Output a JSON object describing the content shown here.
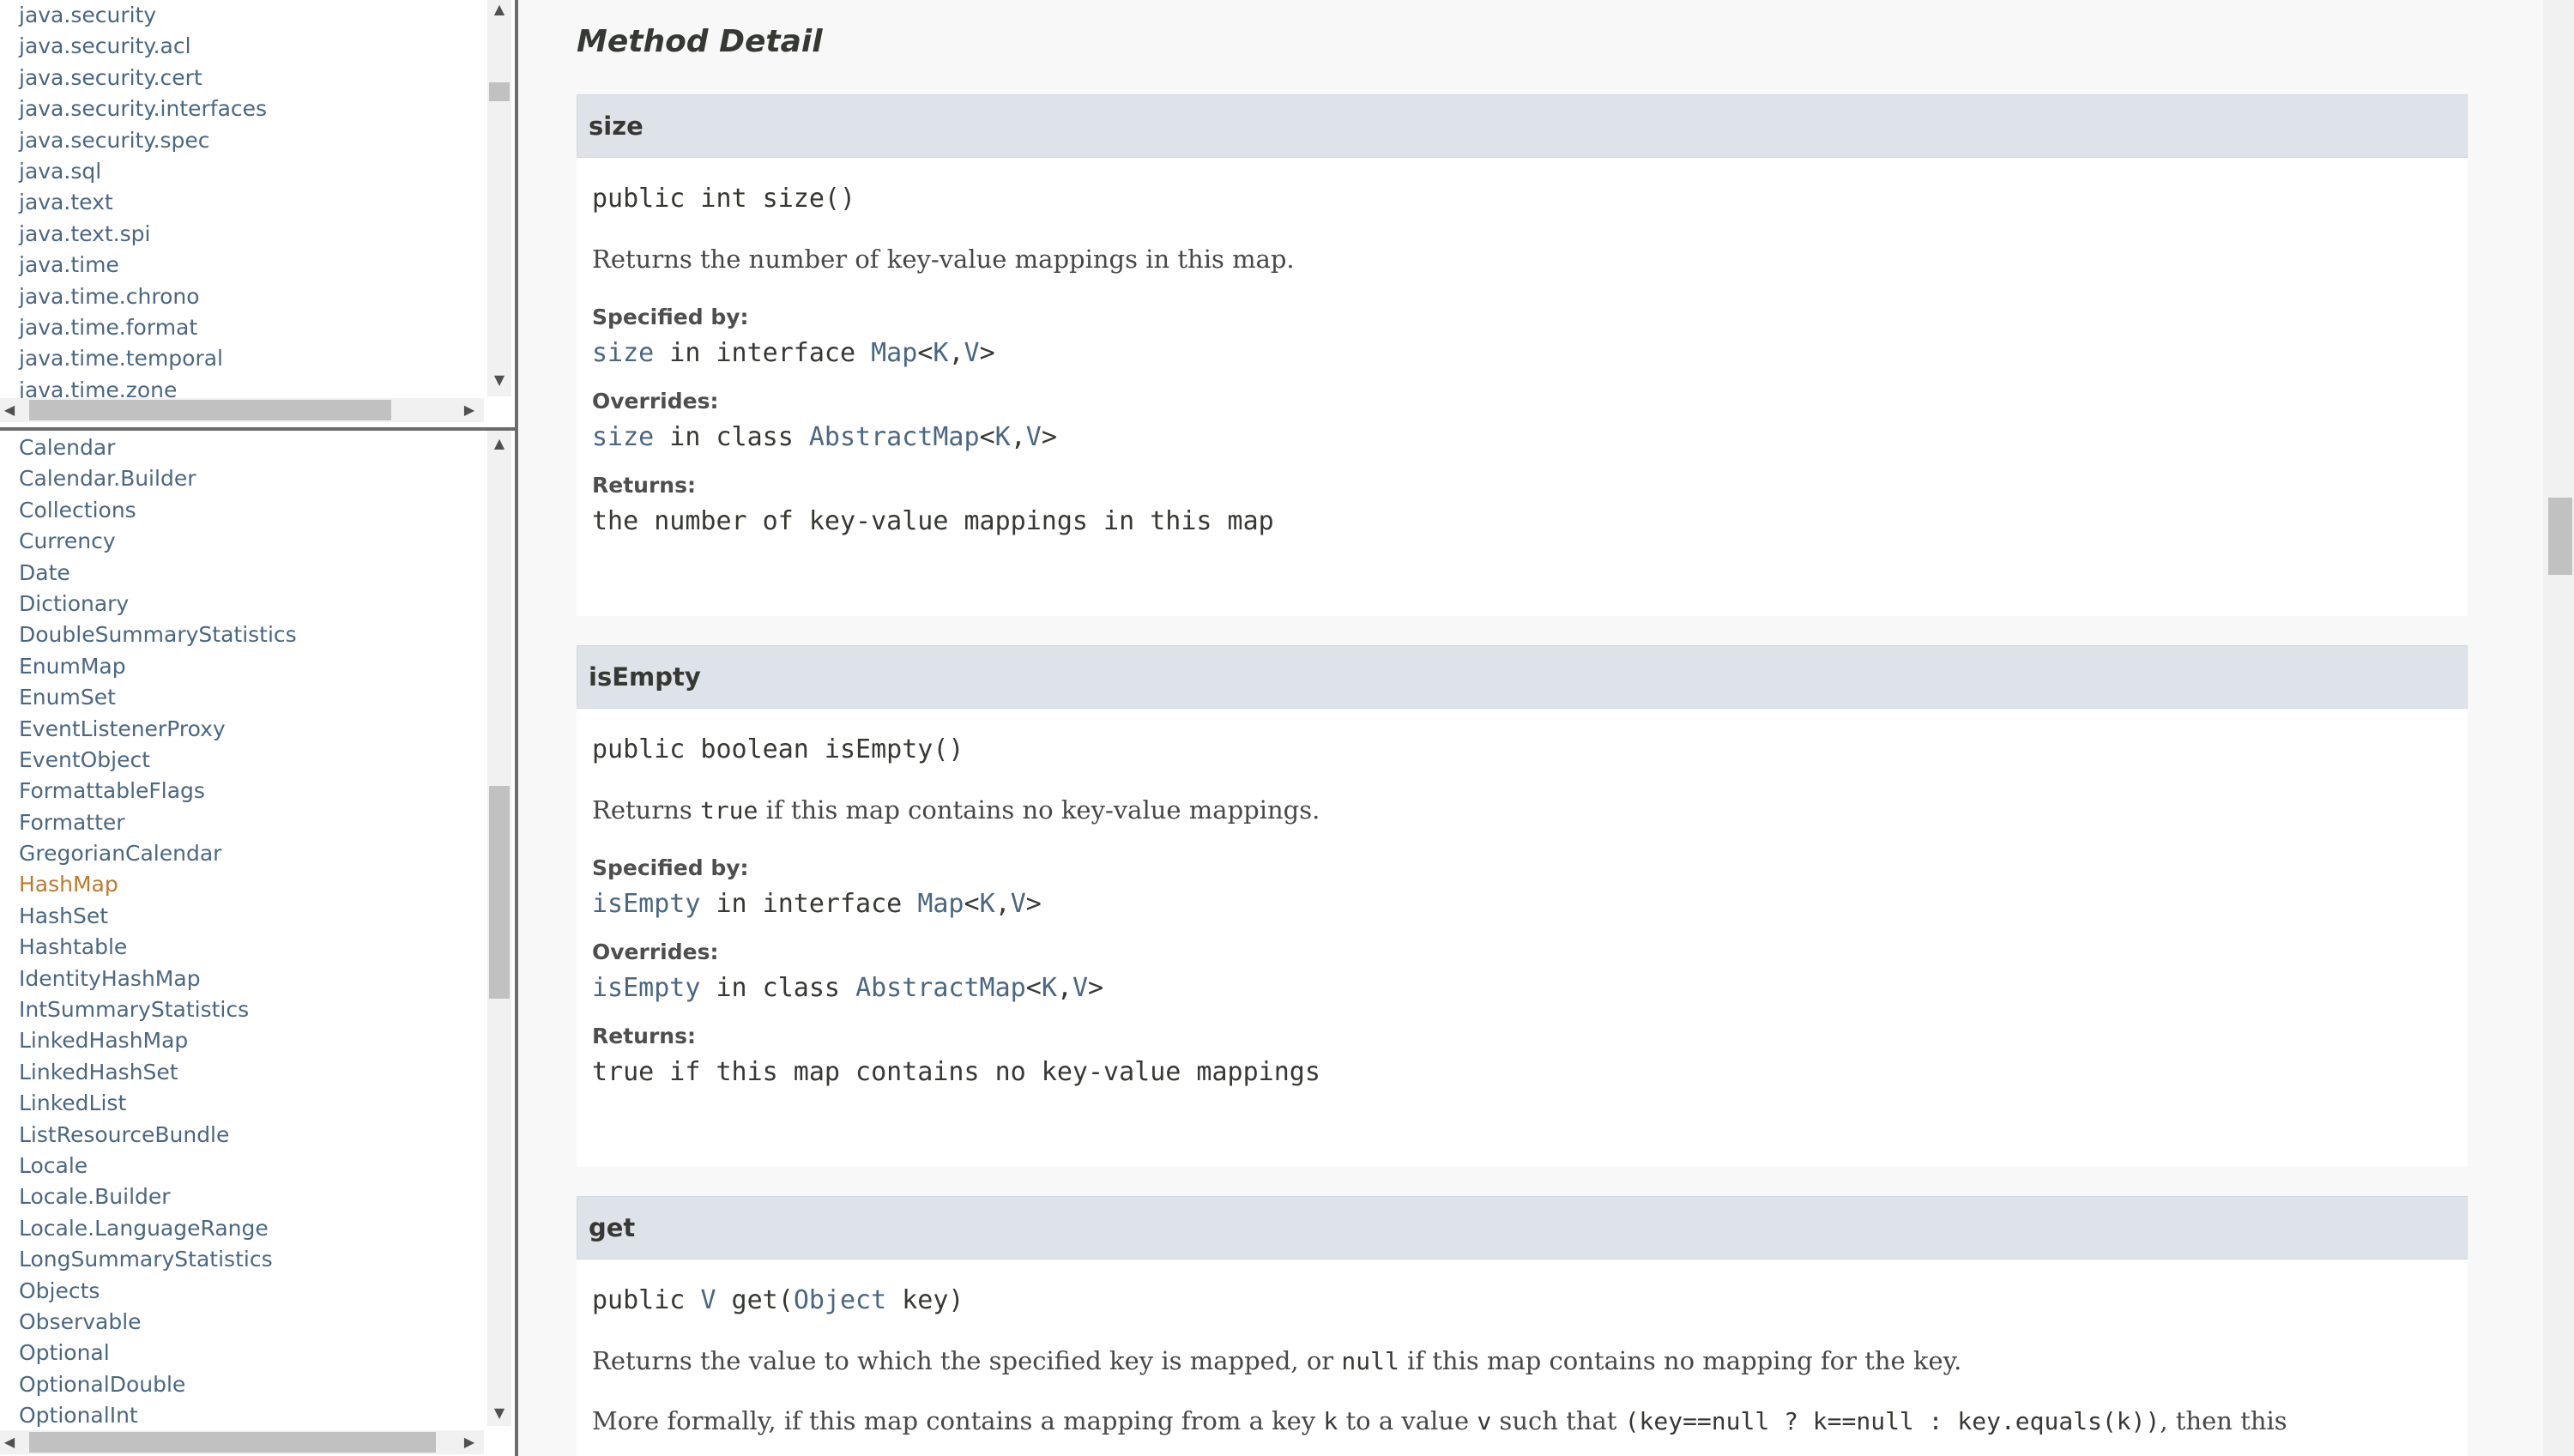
{
  "packages": [
    "java.security",
    "java.security.acl",
    "java.security.cert",
    "java.security.interfaces",
    "java.security.spec",
    "java.sql",
    "java.text",
    "java.text.spi",
    "java.time",
    "java.time.chrono",
    "java.time.format",
    "java.time.temporal",
    "java.time.zone"
  ],
  "classes": [
    "Calendar",
    "Calendar.Builder",
    "Collections",
    "Currency",
    "Date",
    "Dictionary",
    "DoubleSummaryStatistics",
    "EnumMap",
    "EnumSet",
    "EventListenerProxy",
    "EventObject",
    "FormattableFlags",
    "Formatter",
    "GregorianCalendar",
    "HashMap",
    "HashSet",
    "Hashtable",
    "IdentityHashMap",
    "IntSummaryStatistics",
    "LinkedHashMap",
    "LinkedHashSet",
    "LinkedList",
    "ListResourceBundle",
    "Locale",
    "Locale.Builder",
    "Locale.LanguageRange",
    "LongSummaryStatistics",
    "Objects",
    "Observable",
    "Optional",
    "OptionalDouble",
    "OptionalInt"
  ],
  "current_class": "HashMap",
  "section_title": "Method Detail",
  "methods": {
    "size": {
      "name": "size",
      "signature": "public int size()",
      "description": "Returns the number of key-value mappings in this map.",
      "specified_by_label": "Specified by:",
      "specified_link": "size",
      "specified_text": " in interface ",
      "specified_type": "Map",
      "overrides_label": "Overrides:",
      "overrides_link": "size",
      "overrides_text": " in class ",
      "overrides_type": "AbstractMap",
      "returns_label": "Returns:",
      "returns_text": "the number of key-value mappings in this map"
    },
    "isEmpty": {
      "name": "isEmpty",
      "signature": "public boolean isEmpty()",
      "desc_pre": "Returns ",
      "desc_code": "true",
      "desc_post": " if this map contains no key-value mappings.",
      "specified_by_label": "Specified by:",
      "specified_link": "isEmpty",
      "specified_text": " in interface ",
      "specified_type": "Map",
      "overrides_label": "Overrides:",
      "overrides_link": "isEmpty",
      "overrides_text": " in class ",
      "overrides_type": "AbstractMap",
      "returns_label": "Returns:",
      "returns_text": "true if this map contains no key-value mappings"
    },
    "get": {
      "name": "get",
      "sig_pre": "public ",
      "sig_v": "V",
      "sig_mid": " get(",
      "sig_obj": "Object",
      "sig_post": " key)",
      "d1_pre": "Returns the value to which the specified key is mapped, or ",
      "d1_code": "null",
      "d1_post": " if this map contains no mapping for the key.",
      "d2_pre": "More formally, if this map contains a mapping from a key ",
      "d2_k": "k",
      "d2_mid1": " to a value ",
      "d2_v": "v",
      "d2_mid2": " such that ",
      "d2_code": "(key==null ? k==null : key.equals(k))",
      "d2_post": ", then this"
    }
  },
  "generic_k": "K",
  "generic_v": "V",
  "colors": {
    "link": "#4a6782",
    "current": "#bb7a2a",
    "header_bg": "#dee3e9"
  }
}
